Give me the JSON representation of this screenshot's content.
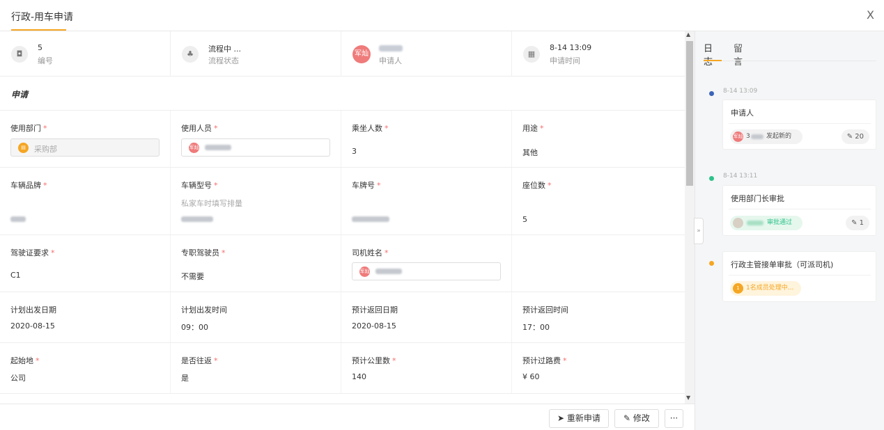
{
  "window": {
    "title": "行政-用车申请",
    "close": "X"
  },
  "info": [
    {
      "icon": "document-icon",
      "glyph": "◘",
      "value": "5",
      "label": "编号"
    },
    {
      "icon": "flow-icon",
      "glyph": "♣",
      "value": "流程中 ...",
      "label": "流程状态"
    },
    {
      "icon": "applicant-avatar",
      "glyph": "军灿",
      "value": "",
      "label": "申请人"
    },
    {
      "icon": "calendar-icon",
      "glyph": "▦",
      "value": "8-14 13:09",
      "label": "申请时间"
    }
  ],
  "section_title": "申请",
  "fields": {
    "dept": {
      "label": "使用部门",
      "value": "采购部"
    },
    "user": {
      "label": "使用人员",
      "avatar": "军灿"
    },
    "passengers": {
      "label": "乘坐人数",
      "value": "3"
    },
    "purpose": {
      "label": "用途",
      "value": "其他"
    },
    "brand": {
      "label": "车辆品牌"
    },
    "model": {
      "label": "车辆型号",
      "hint": "私家车时填写排量"
    },
    "plate": {
      "label": "车牌号"
    },
    "seats": {
      "label": "座位数",
      "value": "5"
    },
    "license": {
      "label": "驾驶证要求",
      "value": "C1"
    },
    "driver_needed": {
      "label": "专职驾驶员",
      "value": "不需要"
    },
    "driver_name": {
      "label": "司机姓名",
      "avatar": "军灿"
    },
    "depart_date": {
      "label": "计划出发日期",
      "value": "2020-08-15"
    },
    "depart_time": {
      "label": "计划出发时间",
      "value": "09：00"
    },
    "return_date": {
      "label": "预计返回日期",
      "value": "2020-08-15"
    },
    "return_time": {
      "label": "预计返回时间",
      "value": "17：00"
    },
    "origin": {
      "label": "起始地",
      "value": "公司"
    },
    "roundtrip": {
      "label": "是否往返",
      "value": "是"
    },
    "distance": {
      "label": "预计公里数",
      "value": "140"
    },
    "toll": {
      "label": "预计过路费",
      "value": "¥ 60"
    }
  },
  "required_mark": "*",
  "footer": {
    "reapply": "重新申请",
    "edit": "修改",
    "more": "···"
  },
  "side": {
    "tabs": [
      "日志",
      "留言"
    ],
    "timeline": [
      {
        "time": "8-14 13:09",
        "title": "申请人",
        "pill_avatar": "军灿",
        "pill_prefix": "3",
        "pill_text": "发起新的",
        "count": "20",
        "color": "#3b63b8"
      },
      {
        "time": "8-14 13:11",
        "title": "使用部门长审批",
        "pill_text": "审批通过",
        "count": "1",
        "color": "#2cc28b"
      },
      {
        "title": "行政主管接单审批（可派司机)",
        "pill_avatar": "1",
        "pill_text": "1名成员处理中...",
        "color": "#f5a623"
      }
    ],
    "collapse": "»"
  }
}
